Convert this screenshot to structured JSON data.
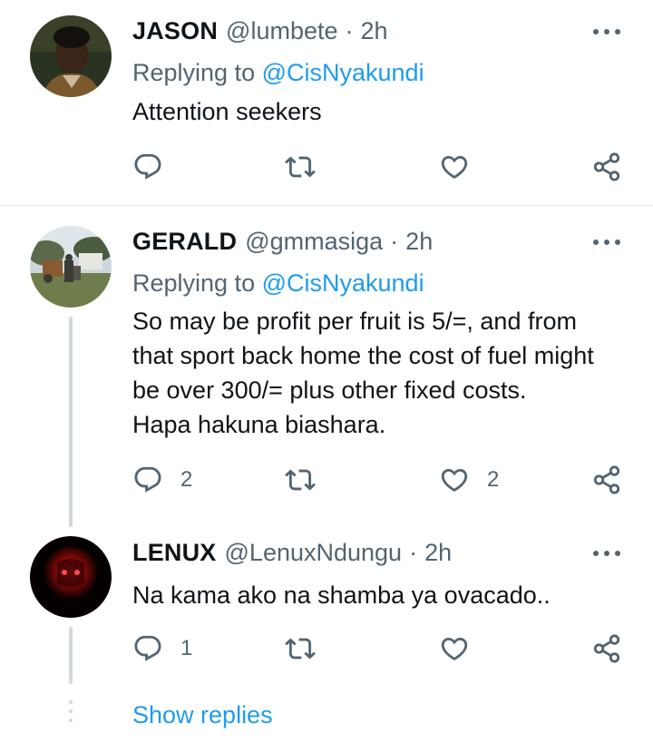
{
  "tweets": [
    {
      "name": "JASON",
      "handle": "@lumbete",
      "dot": "·",
      "time": "2h",
      "replying_prefix": "Replying to ",
      "replying_to": "@CisNyakundi",
      "text_lines": [
        "Attention seekers"
      ],
      "reply_count": "",
      "retweet_count": "",
      "like_count": ""
    },
    {
      "name": "GERALD",
      "handle": "@gmmasiga",
      "dot": "·",
      "time": "2h",
      "replying_prefix": "Replying to ",
      "replying_to": "@CisNyakundi",
      "text_lines": [
        "So may be profit per fruit is 5/=, and from",
        "that sport back home the cost of fuel might",
        "be over 300/= plus other fixed costs.",
        "Hapa hakuna biashara."
      ],
      "reply_count": "2",
      "retweet_count": "",
      "like_count": "2"
    },
    {
      "name": "LENUX",
      "handle": "@LenuxNdungu",
      "dot": "·",
      "time": "2h",
      "text_lines": [
        "Na kama ako na shamba ya ovacado.."
      ],
      "reply_count": "1",
      "retweet_count": "",
      "like_count": ""
    }
  ],
  "show_replies": "Show replies",
  "icons": {
    "reply": "reply-icon",
    "retweet": "retweet-icon",
    "like": "heart-icon",
    "share": "share-icon",
    "more": "more-options-icon"
  },
  "colors": {
    "text": "#0f1419",
    "secondary": "#536471",
    "accent": "#1d9bf0",
    "thread_line": "#cfd9de",
    "divider": "#e6ecf0"
  }
}
